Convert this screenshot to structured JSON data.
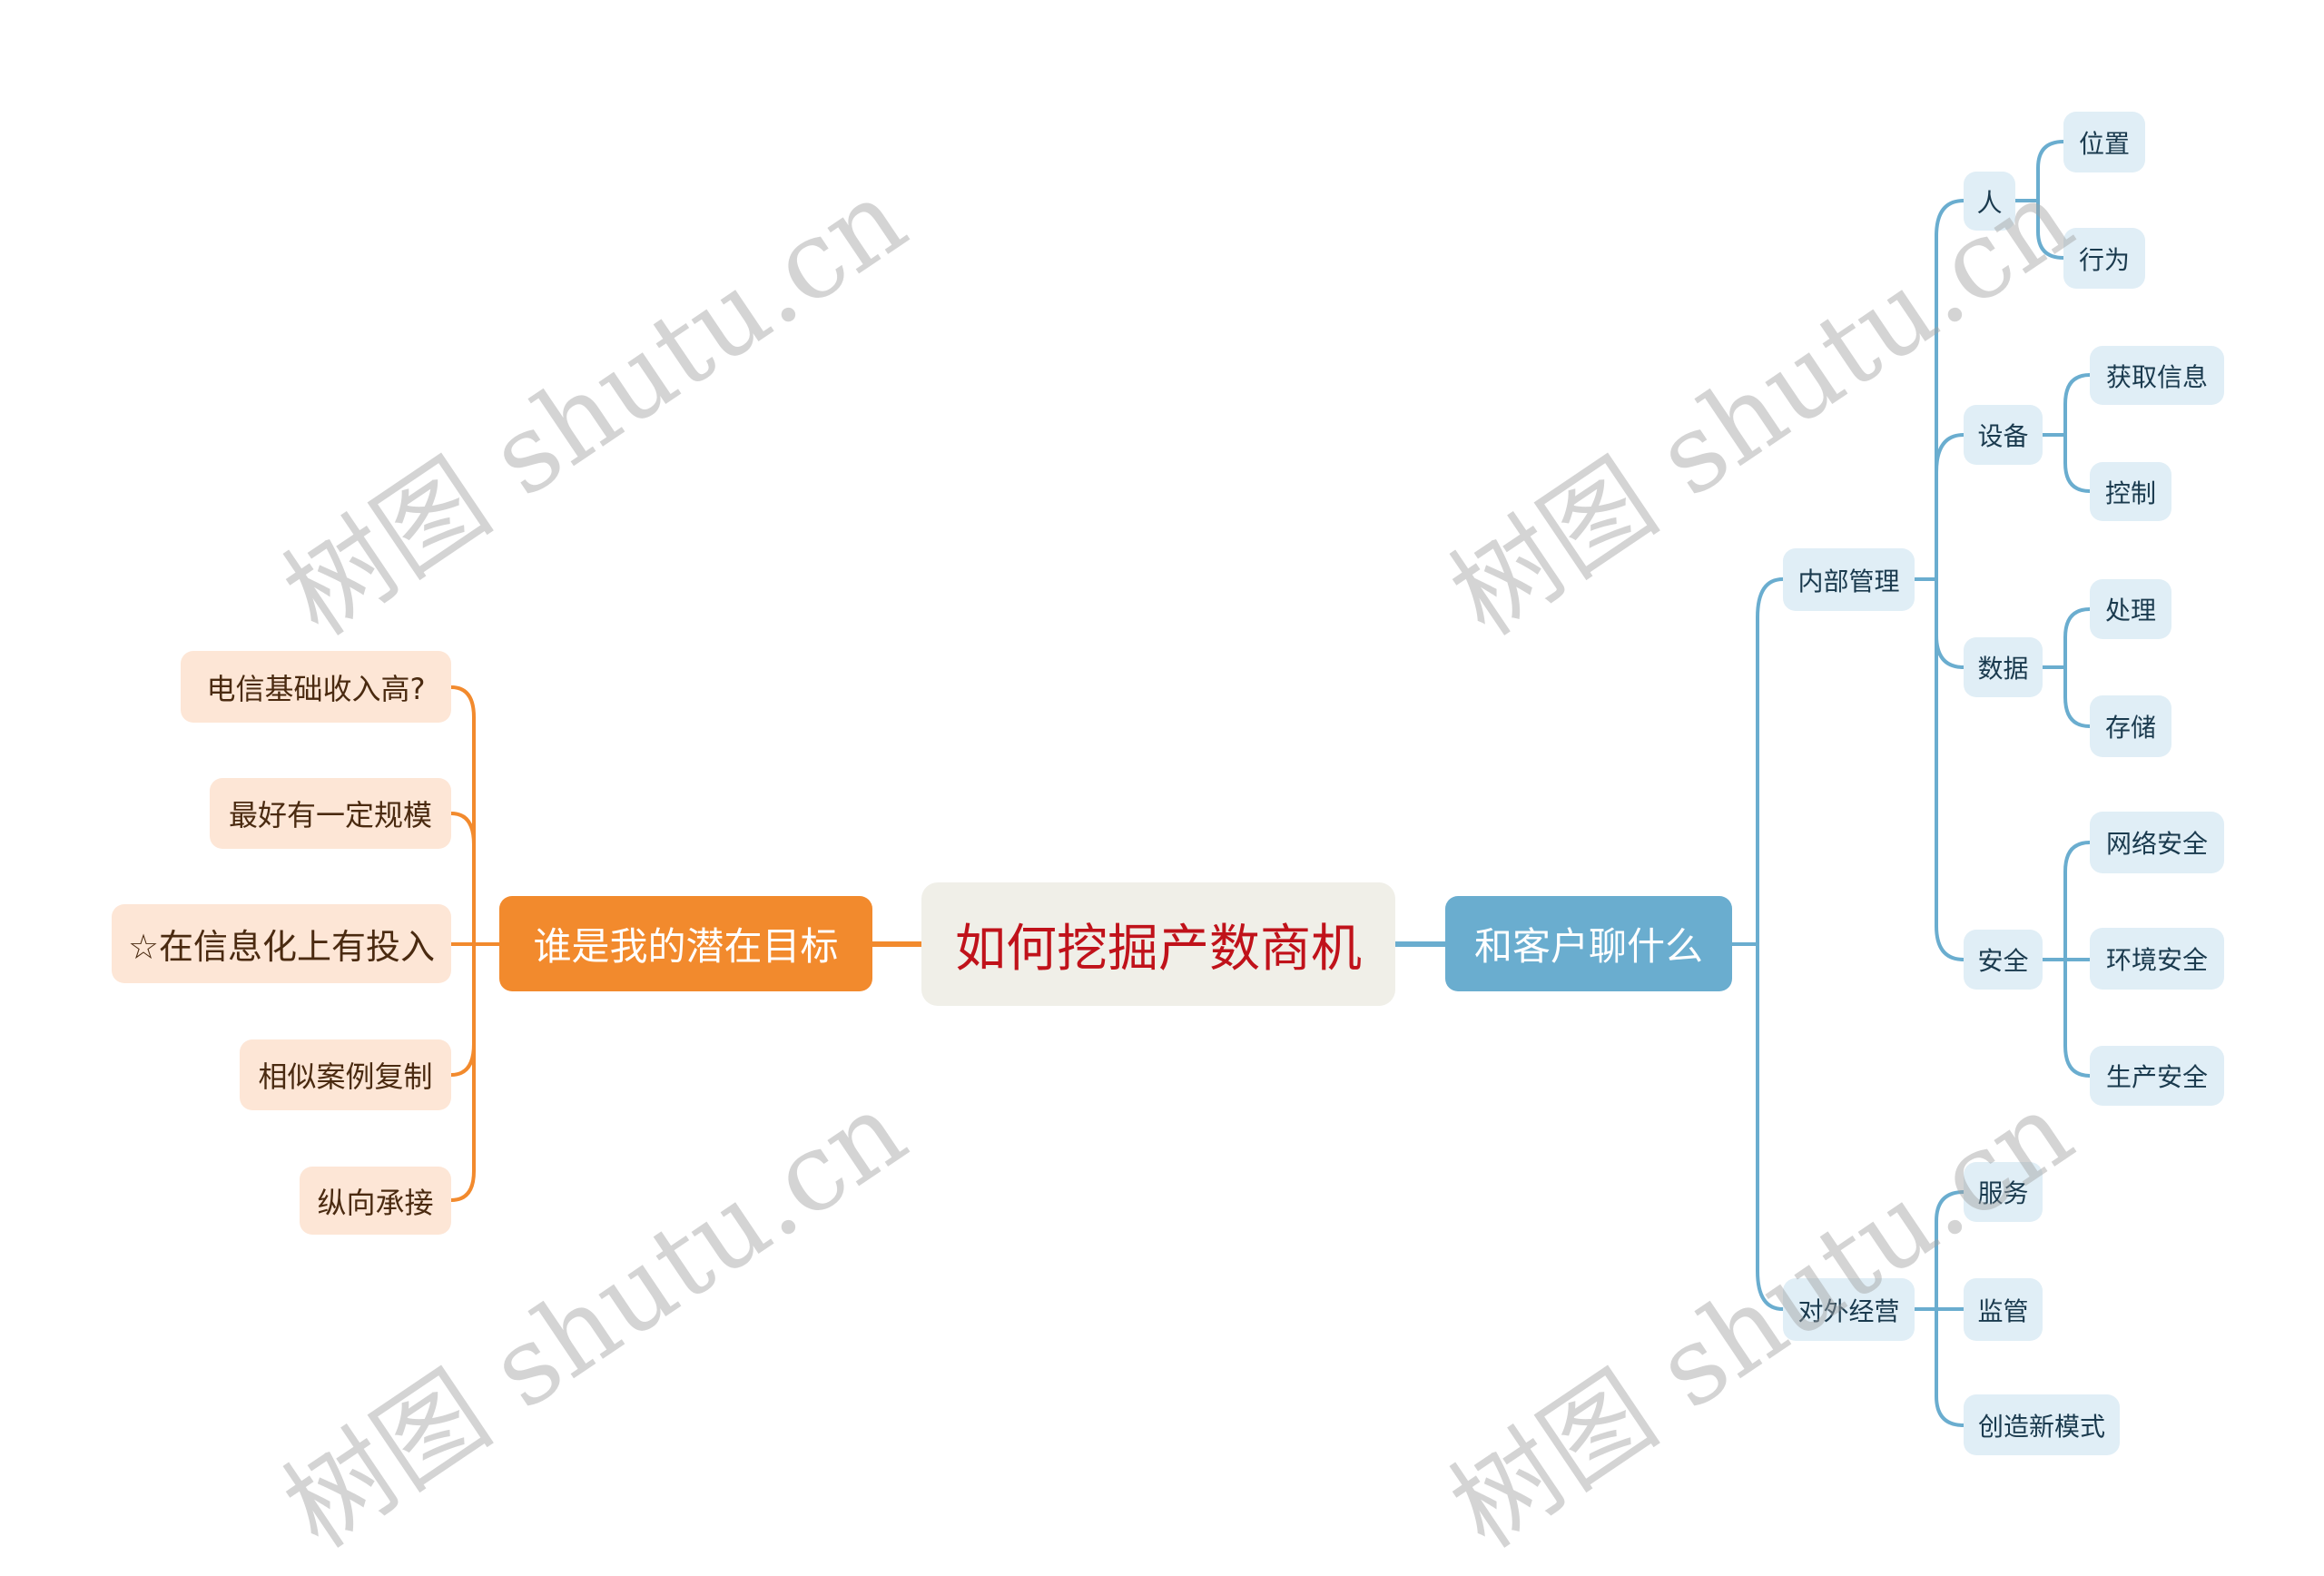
{
  "title": "如何挖掘产数商机",
  "colors": {
    "root_bg": "#f0efe8",
    "root_text": "#c0121a",
    "orange": "#f28a2d",
    "orange_leaf_bg": "#fde6d6",
    "blue": "#6aadcf",
    "blue_leaf_bg": "#e0eef6",
    "watermark": "#c8c8c8"
  },
  "watermark_text": "树图 shutu.cn",
  "left_branch": {
    "label": "谁是我的潜在目标",
    "children": [
      "电信基础收入高?",
      "最好有一定规模",
      "☆在信息化上有投入",
      "相似案例复制",
      "纵向承接"
    ]
  },
  "right_branch": {
    "label": "和客户聊什么",
    "children": [
      {
        "label": "内部管理",
        "children": [
          {
            "label": "人",
            "children": [
              "位置",
              "行为"
            ]
          },
          {
            "label": "设备",
            "children": [
              "获取信息",
              "控制"
            ]
          },
          {
            "label": "数据",
            "children": [
              "处理",
              "存储"
            ]
          },
          {
            "label": "安全",
            "children": [
              "网络安全",
              "环境安全",
              "生产安全"
            ]
          }
        ]
      },
      {
        "label": "对外经营",
        "children": [
          {
            "label": "服务",
            "children": []
          },
          {
            "label": "监管",
            "children": []
          },
          {
            "label": "创造新模式",
            "children": []
          }
        ]
      }
    ]
  }
}
